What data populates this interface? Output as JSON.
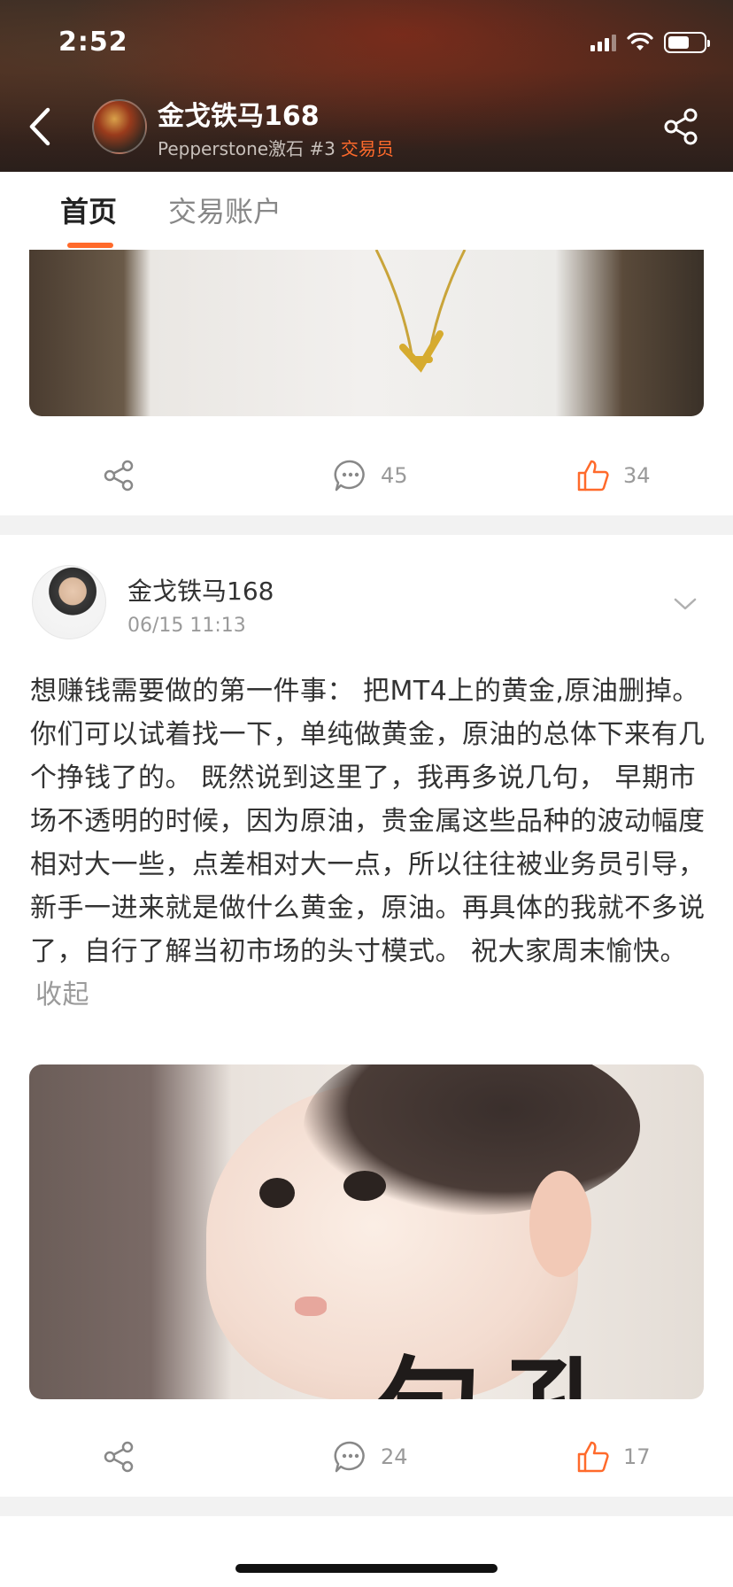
{
  "status_bar": {
    "time": "2:52"
  },
  "header": {
    "name": "金戈铁马168",
    "subtitle": "Pepperstone激石 #3",
    "role": "交易员"
  },
  "tabs": [
    {
      "label": "首页",
      "active": true
    },
    {
      "label": "交易账户",
      "active": false
    }
  ],
  "posts": [
    {
      "comments": "45",
      "likes": "34"
    },
    {
      "author": "金戈铁马168",
      "time": "06/15 11:13",
      "body": "想赚钱需要做的第一件事： 把MT4上的黄金,原油删掉。 你们可以试着找一下，单纯做黄金，原油的总体下来有几个挣钱了的。 既然说到这里了，我再多说几句， 早期市场不透明的时候，因为原油，贵金属这些品种的波动幅度相对大一些，点差相对大一点，所以往往被业务员引导，新手一进来就是做什么黄金，原油。再具体的我就不多说了，自行了解当初市场的头寸模式。 祝大家周末愉快。",
      "collapse": "收起",
      "image_text": "句孔",
      "comments": "24",
      "likes": "17"
    }
  ],
  "colors": {
    "accent": "#ff6a2b",
    "muted": "#9a9a9a"
  },
  "icons": [
    "back-icon",
    "share-icon",
    "comment-icon",
    "like-icon",
    "chevron-down-icon",
    "wifi-icon",
    "signal-icon",
    "battery-icon"
  ]
}
